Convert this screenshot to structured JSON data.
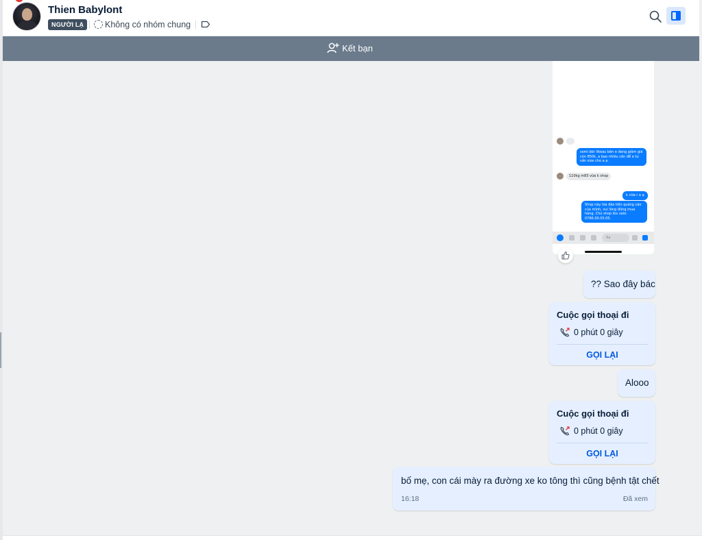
{
  "header": {
    "name": "Thien Babylont",
    "badge": "NGƯỜI LẠ",
    "group_status": "Không có nhóm chung"
  },
  "friend_bar": {
    "label": "Kết bạn"
  },
  "screenshot_content": {
    "msg1": "somi bbr likeau bên e đang giảm giá còn 850k, a bao nhiêu cân để e tư vấn size cho a ạ.",
    "msg2": "110kg m83 vừa k shop",
    "msg3": "k vừa r a ạ",
    "msg4": "Shop này lừa đảo tiền quảng cáo của mình, vui lòng đừng mua hàng. Chủ shop ibx zalo: 0766.00.05.05.",
    "input_placeholder": "Aa"
  },
  "messages": {
    "m1": "?? Sao đây bác",
    "call1": {
      "title": "Cuộc gọi thoại đi",
      "duration": "0 phút 0 giây",
      "action": "GỌI LẠI"
    },
    "m2": "Alooo",
    "call2": {
      "title": "Cuộc gọi thoại đi",
      "duration": "0 phút 0 giây",
      "action": "GỌI LẠI"
    },
    "m3": "bố mẹ, con cái mày ra đường xe ko tông thì cũng bệnh tật chết",
    "m3_time": "16:18",
    "m3_status": "Đã xem"
  },
  "colors": {
    "accent": "#0068ff",
    "bubble": "#e5efff",
    "friend_bar": "#6b7b8c",
    "chat_bg": "#eef0f1"
  }
}
